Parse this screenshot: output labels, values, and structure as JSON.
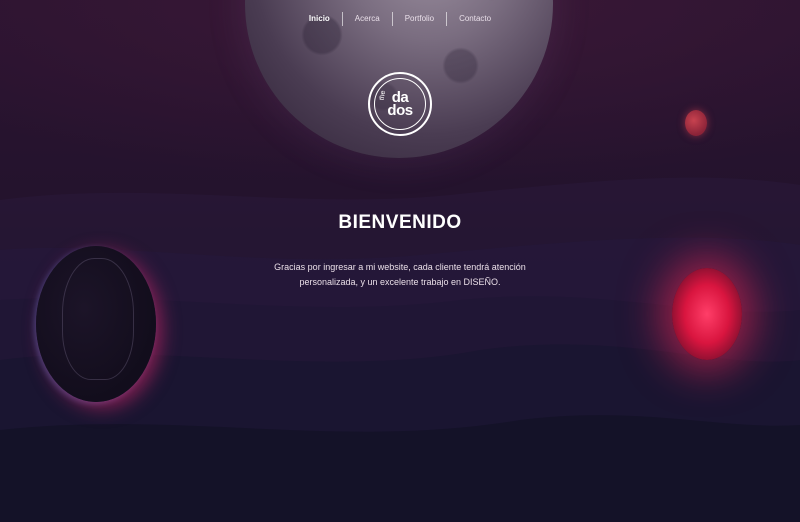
{
  "nav": {
    "items": [
      {
        "label": "Inicio",
        "active": true
      },
      {
        "label": "Acerca",
        "active": false
      },
      {
        "label": "Portfolio",
        "active": false
      },
      {
        "label": "Contacto",
        "active": false
      }
    ]
  },
  "logo": {
    "small": "the",
    "line1": "da",
    "line2": "dos"
  },
  "hero": {
    "title": "BIENVENIDO",
    "text": "Gracias por ingresar a mi website, cada cliente tendrá atención personalizada, y un excelente trabajo en DISEÑO."
  },
  "colors": {
    "background": "#1d1226",
    "accent_red": "#ff3e68",
    "text": "#ffffff"
  }
}
